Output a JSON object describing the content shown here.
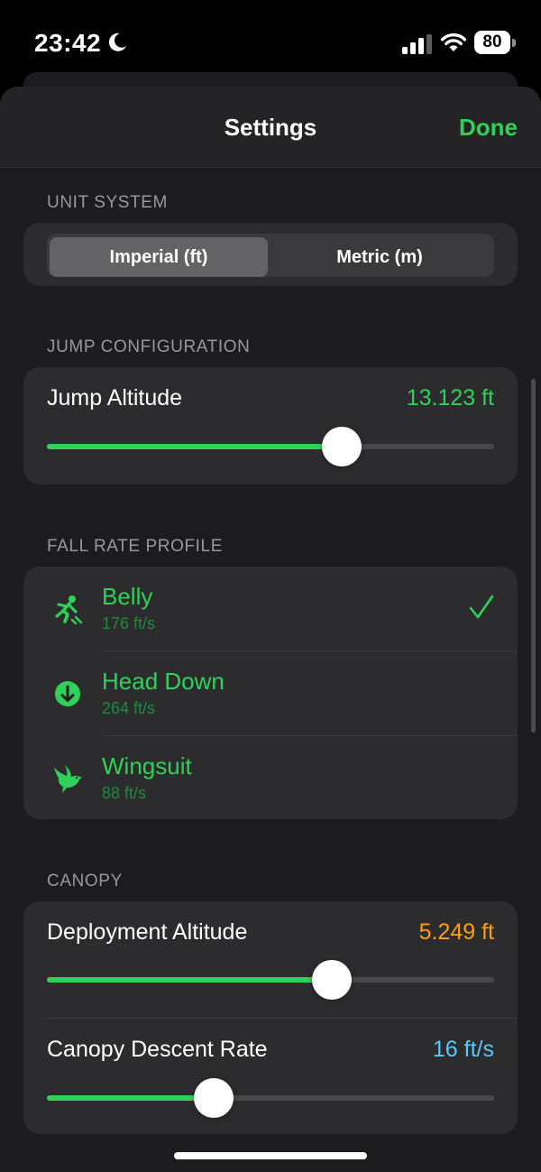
{
  "status_bar": {
    "time": "23:42",
    "battery": "80"
  },
  "nav": {
    "title": "Settings",
    "done_label": "Done"
  },
  "unit_system": {
    "header": "UNIT SYSTEM",
    "options": [
      "Imperial (ft)",
      "Metric (m)"
    ],
    "selected": "Imperial (ft)"
  },
  "jump_configuration": {
    "header": "JUMP CONFIGURATION",
    "altitude_label": "Jump Altitude",
    "altitude_value": "13.123 ft",
    "slider_fraction": 0.66
  },
  "fall_rate_profile": {
    "header": "FALL RATE PROFILE",
    "items": [
      {
        "name": "Belly",
        "rate": "176 ft/s",
        "icon": "person-falling-icon",
        "selected": true
      },
      {
        "name": "Head Down",
        "rate": "264 ft/s",
        "icon": "arrow-down-circle-icon",
        "selected": false
      },
      {
        "name": "Wingsuit",
        "rate": "88 ft/s",
        "icon": "bird-icon",
        "selected": false
      }
    ]
  },
  "canopy": {
    "header": "CANOPY",
    "deployment_label": "Deployment Altitude",
    "deployment_value": "5.249 ft",
    "deployment_fraction": 0.637,
    "descent_label": "Canopy Descent Rate",
    "descent_value": "16 ft/s",
    "descent_fraction": 0.372
  },
  "colors": {
    "accent": "#30d158",
    "deployment": "#ff9f0a",
    "descent": "#5ac8fa"
  }
}
